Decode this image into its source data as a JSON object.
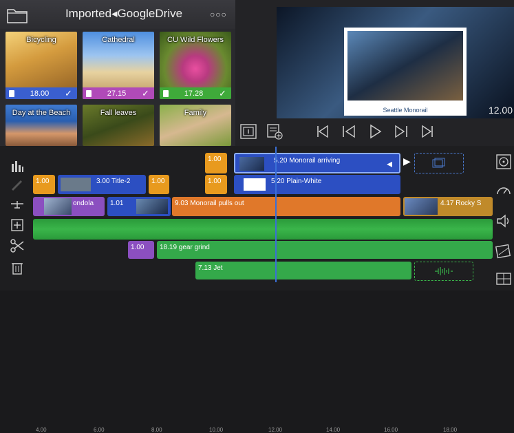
{
  "browser": {
    "title": "Imported◂GoogleDrive",
    "thumbnails": [
      {
        "name": "Bicycling",
        "duration": "18.00",
        "bar_color": "#3a5fd0",
        "checked": true
      },
      {
        "name": "Cathedral",
        "duration": "27.15",
        "bar_color": "#b04ab8",
        "checked": true
      },
      {
        "name": "CU Wild Flowers",
        "duration": "17.28",
        "bar_color": "#3faa3a",
        "checked": true
      },
      {
        "name": "Day at the Beach",
        "duration": "",
        "bar_color": "",
        "checked": false
      },
      {
        "name": "Fall leaves",
        "duration": "",
        "bar_color": "",
        "checked": false
      },
      {
        "name": "Family",
        "duration": "",
        "bar_color": "",
        "checked": false
      }
    ]
  },
  "preview": {
    "caption": "Seattle Monorail",
    "timecode": "12.00"
  },
  "timeline": {
    "clips": {
      "title_a_dur": "1.00",
      "title_b_dur": "1.00",
      "title_2": "3.00 Title-2",
      "title_c_dur": "1.00",
      "a_clip_dur": "1.00",
      "monorail_arriving": "5.20 Monorail arriving",
      "plain_white": "5.20 Plain-White",
      "gondola": "ondola",
      "gondola_dur": "1.01",
      "monorail_pulls_out": "9.03 Monorail pulls out",
      "rocky": "4.17 Rocky S",
      "gear_grind_dur": "1.00",
      "gear_grind": "18.19 gear grind",
      "jet": "7.13 Jet"
    },
    "ruler": [
      "4.00",
      "6.00",
      "8.00",
      "10.00",
      "12.00",
      "14.00",
      "16.00",
      "18.00"
    ]
  },
  "colors": {
    "blue": "#2c4fc2",
    "orange": "#e08a1e",
    "green": "#34a94a",
    "purple": "#8b4fc0",
    "playhead": "#3a6fd6"
  }
}
